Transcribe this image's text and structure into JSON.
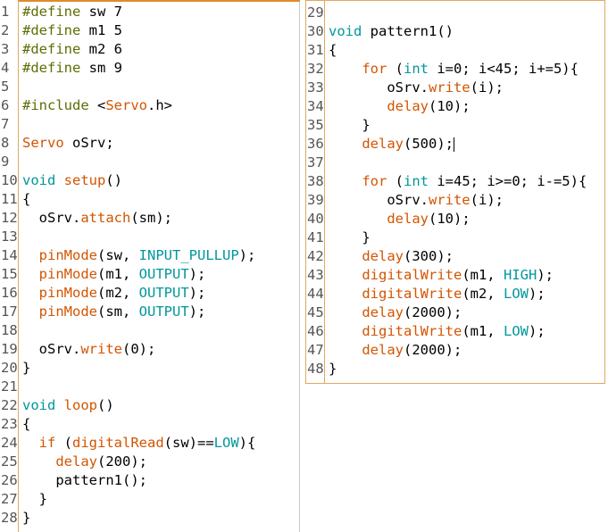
{
  "colors": {
    "preprocessor": "#5e6d03",
    "keyword_type": "#00979c",
    "function": "#d35400",
    "constant": "#00979c",
    "plain": "#000000",
    "gutter_border": "#e0a860"
  },
  "left_pane": {
    "lines": [
      {
        "n": "1",
        "tokens": [
          {
            "t": "#define",
            "c": "pre"
          },
          {
            "t": " sw 7",
            "c": "plain"
          }
        ]
      },
      {
        "n": "2",
        "tokens": [
          {
            "t": "#define",
            "c": "pre"
          },
          {
            "t": " m1 5",
            "c": "plain"
          }
        ]
      },
      {
        "n": "3",
        "tokens": [
          {
            "t": "#define",
            "c": "pre"
          },
          {
            "t": " m2 6",
            "c": "plain"
          }
        ]
      },
      {
        "n": "4",
        "tokens": [
          {
            "t": "#define",
            "c": "pre"
          },
          {
            "t": " sm 9",
            "c": "plain"
          }
        ]
      },
      {
        "n": "5",
        "tokens": []
      },
      {
        "n": "6",
        "tokens": [
          {
            "t": "#include",
            "c": "pre"
          },
          {
            "t": " <",
            "c": "plain"
          },
          {
            "t": "Servo",
            "c": "fn"
          },
          {
            "t": ".h>",
            "c": "plain"
          }
        ]
      },
      {
        "n": "7",
        "tokens": []
      },
      {
        "n": "8",
        "tokens": [
          {
            "t": "Servo",
            "c": "fn"
          },
          {
            "t": " oSrv;",
            "c": "plain"
          }
        ]
      },
      {
        "n": "9",
        "tokens": []
      },
      {
        "n": "10",
        "tokens": [
          {
            "t": "void",
            "c": "type"
          },
          {
            "t": " ",
            "c": "plain"
          },
          {
            "t": "setup",
            "c": "fn"
          },
          {
            "t": "()",
            "c": "plain"
          }
        ]
      },
      {
        "n": "11",
        "tokens": [
          {
            "t": "{",
            "c": "plain"
          }
        ]
      },
      {
        "n": "12",
        "tokens": [
          {
            "t": "  oSrv.",
            "c": "plain"
          },
          {
            "t": "attach",
            "c": "fn"
          },
          {
            "t": "(sm);",
            "c": "plain"
          }
        ]
      },
      {
        "n": "13",
        "tokens": []
      },
      {
        "n": "14",
        "tokens": [
          {
            "t": "  ",
            "c": "plain"
          },
          {
            "t": "pinMode",
            "c": "fn"
          },
          {
            "t": "(sw, ",
            "c": "plain"
          },
          {
            "t": "INPUT_PULLUP",
            "c": "const"
          },
          {
            "t": ");",
            "c": "plain"
          }
        ]
      },
      {
        "n": "15",
        "tokens": [
          {
            "t": "  ",
            "c": "plain"
          },
          {
            "t": "pinMode",
            "c": "fn"
          },
          {
            "t": "(m1, ",
            "c": "plain"
          },
          {
            "t": "OUTPUT",
            "c": "const"
          },
          {
            "t": ");",
            "c": "plain"
          }
        ]
      },
      {
        "n": "16",
        "tokens": [
          {
            "t": "  ",
            "c": "plain"
          },
          {
            "t": "pinMode",
            "c": "fn"
          },
          {
            "t": "(m2, ",
            "c": "plain"
          },
          {
            "t": "OUTPUT",
            "c": "const"
          },
          {
            "t": ");",
            "c": "plain"
          }
        ]
      },
      {
        "n": "17",
        "tokens": [
          {
            "t": "  ",
            "c": "plain"
          },
          {
            "t": "pinMode",
            "c": "fn"
          },
          {
            "t": "(sm, ",
            "c": "plain"
          },
          {
            "t": "OUTPUT",
            "c": "const"
          },
          {
            "t": ");",
            "c": "plain"
          }
        ]
      },
      {
        "n": "18",
        "tokens": []
      },
      {
        "n": "19",
        "tokens": [
          {
            "t": "  oSrv.",
            "c": "plain"
          },
          {
            "t": "write",
            "c": "fn"
          },
          {
            "t": "(0);",
            "c": "plain"
          }
        ]
      },
      {
        "n": "20",
        "tokens": [
          {
            "t": "}",
            "c": "plain"
          }
        ]
      },
      {
        "n": "21",
        "tokens": []
      },
      {
        "n": "22",
        "tokens": [
          {
            "t": "void",
            "c": "type"
          },
          {
            "t": " ",
            "c": "plain"
          },
          {
            "t": "loop",
            "c": "fn"
          },
          {
            "t": "()",
            "c": "plain"
          }
        ]
      },
      {
        "n": "23",
        "tokens": [
          {
            "t": "{",
            "c": "plain"
          }
        ]
      },
      {
        "n": "24",
        "tokens": [
          {
            "t": "  ",
            "c": "plain"
          },
          {
            "t": "if",
            "c": "fn"
          },
          {
            "t": " (",
            "c": "plain"
          },
          {
            "t": "digitalRead",
            "c": "fn"
          },
          {
            "t": "(sw)==",
            "c": "plain"
          },
          {
            "t": "LOW",
            "c": "const"
          },
          {
            "t": "){",
            "c": "plain"
          }
        ]
      },
      {
        "n": "25",
        "tokens": [
          {
            "t": "    ",
            "c": "plain"
          },
          {
            "t": "delay",
            "c": "fn"
          },
          {
            "t": "(200);",
            "c": "plain"
          }
        ]
      },
      {
        "n": "26",
        "tokens": [
          {
            "t": "    pattern1();",
            "c": "plain"
          }
        ]
      },
      {
        "n": "27",
        "tokens": [
          {
            "t": "  }",
            "c": "plain"
          }
        ]
      },
      {
        "n": "28",
        "tokens": [
          {
            "t": "}",
            "c": "plain"
          }
        ]
      }
    ]
  },
  "right_pane": {
    "lines": [
      {
        "n": "29",
        "tokens": []
      },
      {
        "n": "30",
        "tokens": [
          {
            "t": "void",
            "c": "type"
          },
          {
            "t": " pattern1()",
            "c": "plain"
          }
        ]
      },
      {
        "n": "31",
        "tokens": [
          {
            "t": "{",
            "c": "plain"
          }
        ]
      },
      {
        "n": "32",
        "tokens": [
          {
            "t": "    ",
            "c": "plain"
          },
          {
            "t": "for",
            "c": "fn"
          },
          {
            "t": " (",
            "c": "plain"
          },
          {
            "t": "int",
            "c": "type"
          },
          {
            "t": " i=0; i<45; i+=5){",
            "c": "plain"
          }
        ]
      },
      {
        "n": "33",
        "tokens": [
          {
            "t": "       oSrv.",
            "c": "plain"
          },
          {
            "t": "write",
            "c": "fn"
          },
          {
            "t": "(i);",
            "c": "plain"
          }
        ]
      },
      {
        "n": "34",
        "tokens": [
          {
            "t": "       ",
            "c": "plain"
          },
          {
            "t": "delay",
            "c": "fn"
          },
          {
            "t": "(10);",
            "c": "plain"
          }
        ]
      },
      {
        "n": "35",
        "tokens": [
          {
            "t": "    }",
            "c": "plain"
          }
        ]
      },
      {
        "n": "36",
        "tokens": [
          {
            "t": "    ",
            "c": "plain"
          },
          {
            "t": "delay",
            "c": "fn"
          },
          {
            "t": "(500);",
            "c": "plain"
          }
        ],
        "cursor": true
      },
      {
        "n": "37",
        "tokens": []
      },
      {
        "n": "38",
        "tokens": [
          {
            "t": "    ",
            "c": "plain"
          },
          {
            "t": "for",
            "c": "fn"
          },
          {
            "t": " (",
            "c": "plain"
          },
          {
            "t": "int",
            "c": "type"
          },
          {
            "t": " i=45; i>=0; i-=5){",
            "c": "plain"
          }
        ]
      },
      {
        "n": "39",
        "tokens": [
          {
            "t": "       oSrv.",
            "c": "plain"
          },
          {
            "t": "write",
            "c": "fn"
          },
          {
            "t": "(i);",
            "c": "plain"
          }
        ]
      },
      {
        "n": "40",
        "tokens": [
          {
            "t": "       ",
            "c": "plain"
          },
          {
            "t": "delay",
            "c": "fn"
          },
          {
            "t": "(10);",
            "c": "plain"
          }
        ]
      },
      {
        "n": "41",
        "tokens": [
          {
            "t": "    }",
            "c": "plain"
          }
        ]
      },
      {
        "n": "42",
        "tokens": [
          {
            "t": "    ",
            "c": "plain"
          },
          {
            "t": "delay",
            "c": "fn"
          },
          {
            "t": "(300);",
            "c": "plain"
          }
        ]
      },
      {
        "n": "43",
        "tokens": [
          {
            "t": "    ",
            "c": "plain"
          },
          {
            "t": "digitalWrite",
            "c": "fn"
          },
          {
            "t": "(m1, ",
            "c": "plain"
          },
          {
            "t": "HIGH",
            "c": "const"
          },
          {
            "t": ");",
            "c": "plain"
          }
        ]
      },
      {
        "n": "44",
        "tokens": [
          {
            "t": "    ",
            "c": "plain"
          },
          {
            "t": "digitalWrite",
            "c": "fn"
          },
          {
            "t": "(m2, ",
            "c": "plain"
          },
          {
            "t": "LOW",
            "c": "const"
          },
          {
            "t": ");",
            "c": "plain"
          }
        ]
      },
      {
        "n": "45",
        "tokens": [
          {
            "t": "    ",
            "c": "plain"
          },
          {
            "t": "delay",
            "c": "fn"
          },
          {
            "t": "(2000);",
            "c": "plain"
          }
        ]
      },
      {
        "n": "46",
        "tokens": [
          {
            "t": "    ",
            "c": "plain"
          },
          {
            "t": "digitalWrite",
            "c": "fn"
          },
          {
            "t": "(m1, ",
            "c": "plain"
          },
          {
            "t": "LOW",
            "c": "const"
          },
          {
            "t": ");",
            "c": "plain"
          }
        ]
      },
      {
        "n": "47",
        "tokens": [
          {
            "t": "    ",
            "c": "plain"
          },
          {
            "t": "delay",
            "c": "fn"
          },
          {
            "t": "(2000);",
            "c": "plain"
          }
        ]
      },
      {
        "n": "48",
        "tokens": [
          {
            "t": "}",
            "c": "plain"
          }
        ]
      }
    ]
  }
}
